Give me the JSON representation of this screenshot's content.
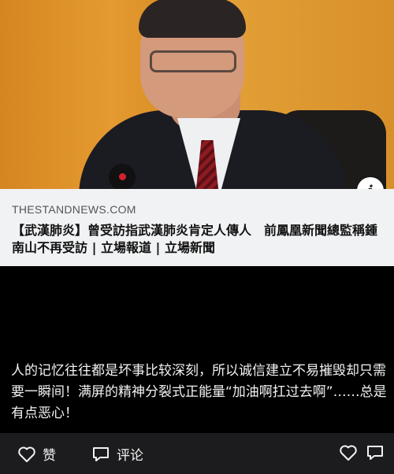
{
  "article_card": {
    "domain": "THESTANDNEWS.COM",
    "headline": "【武漢肺炎】曾受訪指武漢肺炎肯定人傳人　前鳳凰新聞總監稱鍾南山不再受訪 | 立場報道 | 立場新聞",
    "info_icon": "i"
  },
  "post": {
    "text": "人的记忆往往都是坏事比较深刻，所以诚信建立不易摧毁却只需要一瞬间！满屏的精神分裂式正能量“加油啊扛过去啊”……总是有点恶心！"
  },
  "actions": {
    "like_label": "赞",
    "comment_label": "评论"
  },
  "icons": {
    "like": "heart-outline-icon",
    "comment": "chat-bubble-icon",
    "info": "info-icon"
  },
  "colors": {
    "background": "#000000",
    "card": "#f1f2f4",
    "action_bar": "#1c1c1e",
    "text_light": "#f2f2f2"
  }
}
